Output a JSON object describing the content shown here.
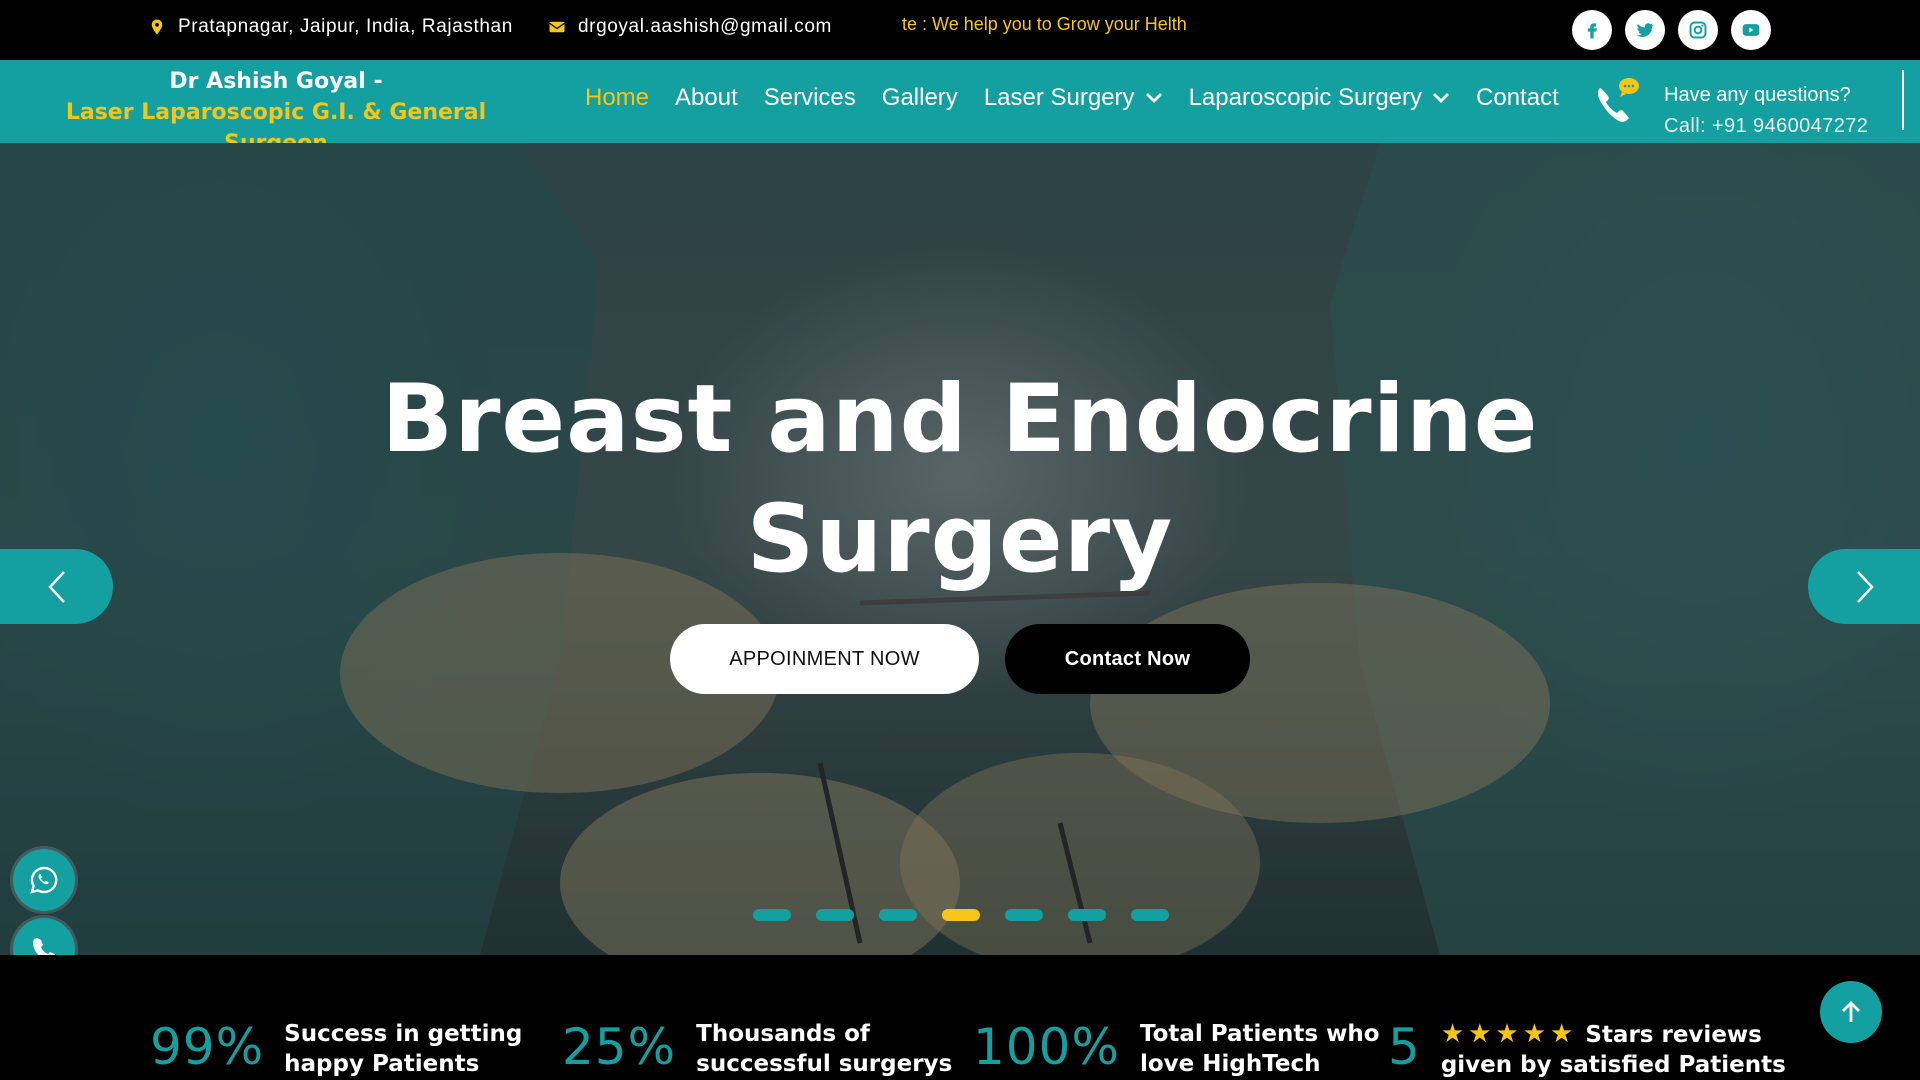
{
  "topbar": {
    "address": "Pratapnagar, Jaipur, India, Rajasthan",
    "email": "drgoyal.aashish@gmail.com",
    "ticker": "ote : We help you to Grow your Helth",
    "social_icons": [
      "facebook-icon",
      "twitter-icon",
      "instagram-icon",
      "youtube-icon"
    ]
  },
  "brand": {
    "line1": "Dr Ashish Goyal -",
    "line2": "Laser Laparoscopic G.I. & General Surgeon"
  },
  "nav": {
    "items": [
      {
        "label": "Home",
        "active": true
      },
      {
        "label": "About"
      },
      {
        "label": "Services"
      },
      {
        "label": "Gallery"
      },
      {
        "label": "Laser Surgery",
        "dropdown": true
      },
      {
        "label": "Laparoscopic Surgery",
        "dropdown": true
      },
      {
        "label": "Contact"
      }
    ],
    "question": "Have any questions?",
    "call": "Call: +91 9460047272"
  },
  "hero": {
    "title": "Breast and Endocrine Surgery",
    "appointment_label": "APPOINMENT NOW",
    "contact_label": "Contact Now",
    "slide_count": 7,
    "active_slide": 4
  },
  "stats": [
    {
      "num": "99%",
      "line1": "Success in getting",
      "line2": "happy Patients"
    },
    {
      "num": "25%",
      "line1": "Thousands of",
      "line2": "successful surgerys"
    },
    {
      "num": "100%",
      "line1": "Total Patients who",
      "line2": "love HighTech"
    },
    {
      "num": "5",
      "stars": "★★★★★",
      "line1": "Stars reviews",
      "line2": "given by satisfied Patients"
    }
  ],
  "colors": {
    "accent": "#14a0a0",
    "highlight": "#f5c518",
    "dark": "#000000"
  }
}
